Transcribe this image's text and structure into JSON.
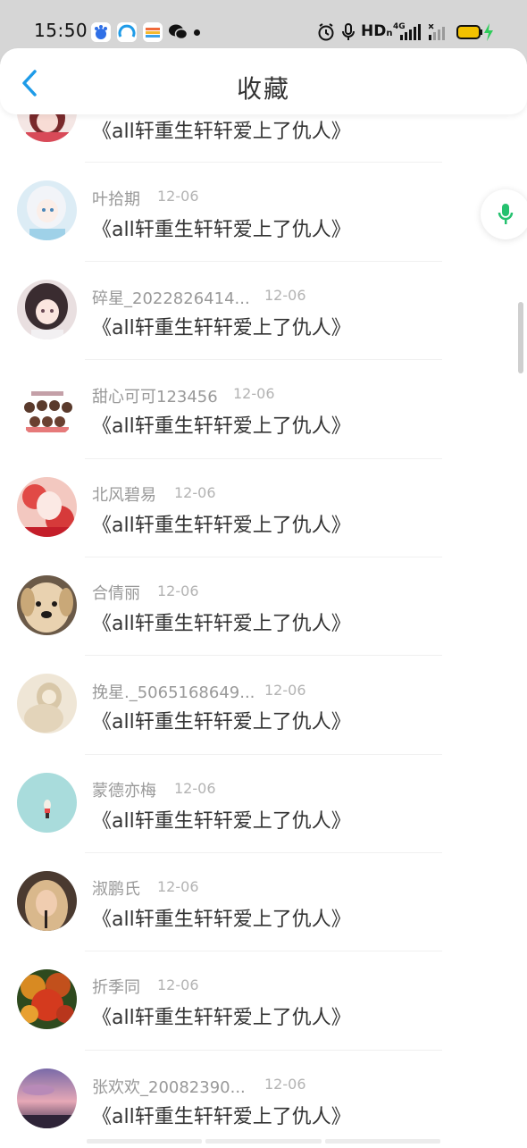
{
  "status_bar": {
    "time": "15:50",
    "network": "HD",
    "network_sub": "n",
    "signal_label": "4G",
    "icons": [
      "baidu-app-icon",
      "browser-app-icon",
      "stripes-app-icon",
      "wechat-icon",
      "alarm-icon",
      "mic-icon",
      "signal-icon",
      "battery-icon",
      "charging-icon"
    ]
  },
  "header": {
    "back_icon": "chevron-left-icon",
    "title": "收藏"
  },
  "colors": {
    "accent": "#1e9be8",
    "mic_green": "#25c16f",
    "username": "#999999",
    "date": "#b3b3b3",
    "title_text": "#333333"
  },
  "items": [
    {
      "user": "",
      "date": "",
      "title": "《all轩重生轩轩爱上了仇人》",
      "avatar": "anime-girl-red-avatar"
    },
    {
      "user": "叶拾期",
      "date": "12-06",
      "title": "《all轩重生轩轩爱上了仇人》",
      "avatar": "anime-white-hair-avatar"
    },
    {
      "user": "碎星_2022826414...",
      "date": "12-06",
      "title": "《all轩重生轩轩爱上了仇人》",
      "avatar": "anime-dark-hair-avatar"
    },
    {
      "user": "甜心可可123456",
      "date": "12-06",
      "title": "《all轩重生轩轩爱上了仇人》",
      "avatar": "cartoon-group-avatar"
    },
    {
      "user": "北风碧易",
      "date": "12-06",
      "title": "《all轩重生轩轩爱上了仇人》",
      "avatar": "red-flower-girl-avatar"
    },
    {
      "user": "合倩丽",
      "date": "12-06",
      "title": "《all轩重生轩轩爱上了仇人》",
      "avatar": "puppy-avatar"
    },
    {
      "user": "挽星._5065168649...",
      "date": "12-06",
      "title": "《all轩重生轩轩爱上了仇人》",
      "avatar": "sepia-portrait-avatar"
    },
    {
      "user": "蒙德亦梅",
      "date": "12-06",
      "title": "《all轩重生轩轩爱上了仇人》",
      "avatar": "teal-ice-cream-avatar"
    },
    {
      "user": "淑鹏氏",
      "date": "12-06",
      "title": "《all轩重生轩轩爱上了仇人》",
      "avatar": "blonde-photo-avatar"
    },
    {
      "user": "折季同",
      "date": "12-06",
      "title": "《all轩重生轩轩爱上了仇人》",
      "avatar": "autumn-tree-avatar"
    },
    {
      "user": "张欢欢_20082390...",
      "date": "12-06",
      "title": "《all轩重生轩轩爱上了仇人》",
      "avatar": "sunset-sky-avatar"
    }
  ],
  "floating": {
    "mic_icon": "microphone-icon"
  }
}
